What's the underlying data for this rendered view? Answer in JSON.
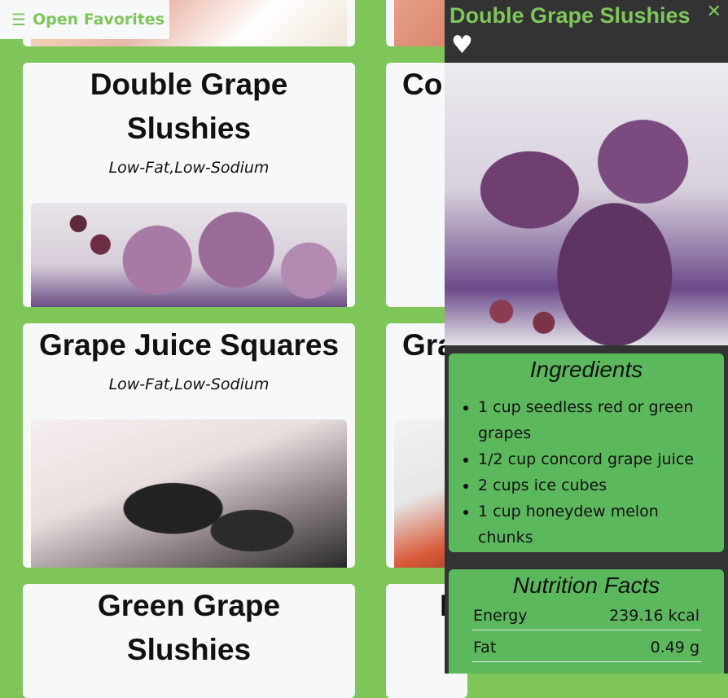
{
  "favorites": {
    "label": "Open Favorites",
    "icon": "hamburger-menu-icon"
  },
  "cards": [
    {
      "title": "Double Grape Slushies",
      "tags": "Low-Fat,Low-Sodium"
    },
    {
      "title": "Co"
    },
    {
      "title": "Grape Juice Squares",
      "tags": "Low-Fat,Low-Sodium"
    },
    {
      "title": "Gra"
    },
    {
      "title": "Green Grape Slushies"
    },
    {
      "title": "I"
    }
  ],
  "detail": {
    "title": "Double Grape Slushies",
    "close_icon": "close-icon",
    "favorite_icon": "heart-icon",
    "ingredients_title": "Ingredients",
    "ingredients": [
      "1 cup seedless red or green grapes",
      "1/2 cup concord grape juice",
      "2 cups ice cubes",
      "1 cup honeydew melon chunks"
    ],
    "nutrition_title": "Nutrition Facts",
    "nutrition": [
      {
        "label": "Energy",
        "value": "239.16 kcal"
      },
      {
        "label": "Fat",
        "value": "0.49 g"
      }
    ]
  },
  "colors": {
    "background": "#7fc65a",
    "card": "#f7f8fa",
    "panel": "#333333",
    "section": "#5cb85c",
    "accent_text": "#7fc65a"
  }
}
